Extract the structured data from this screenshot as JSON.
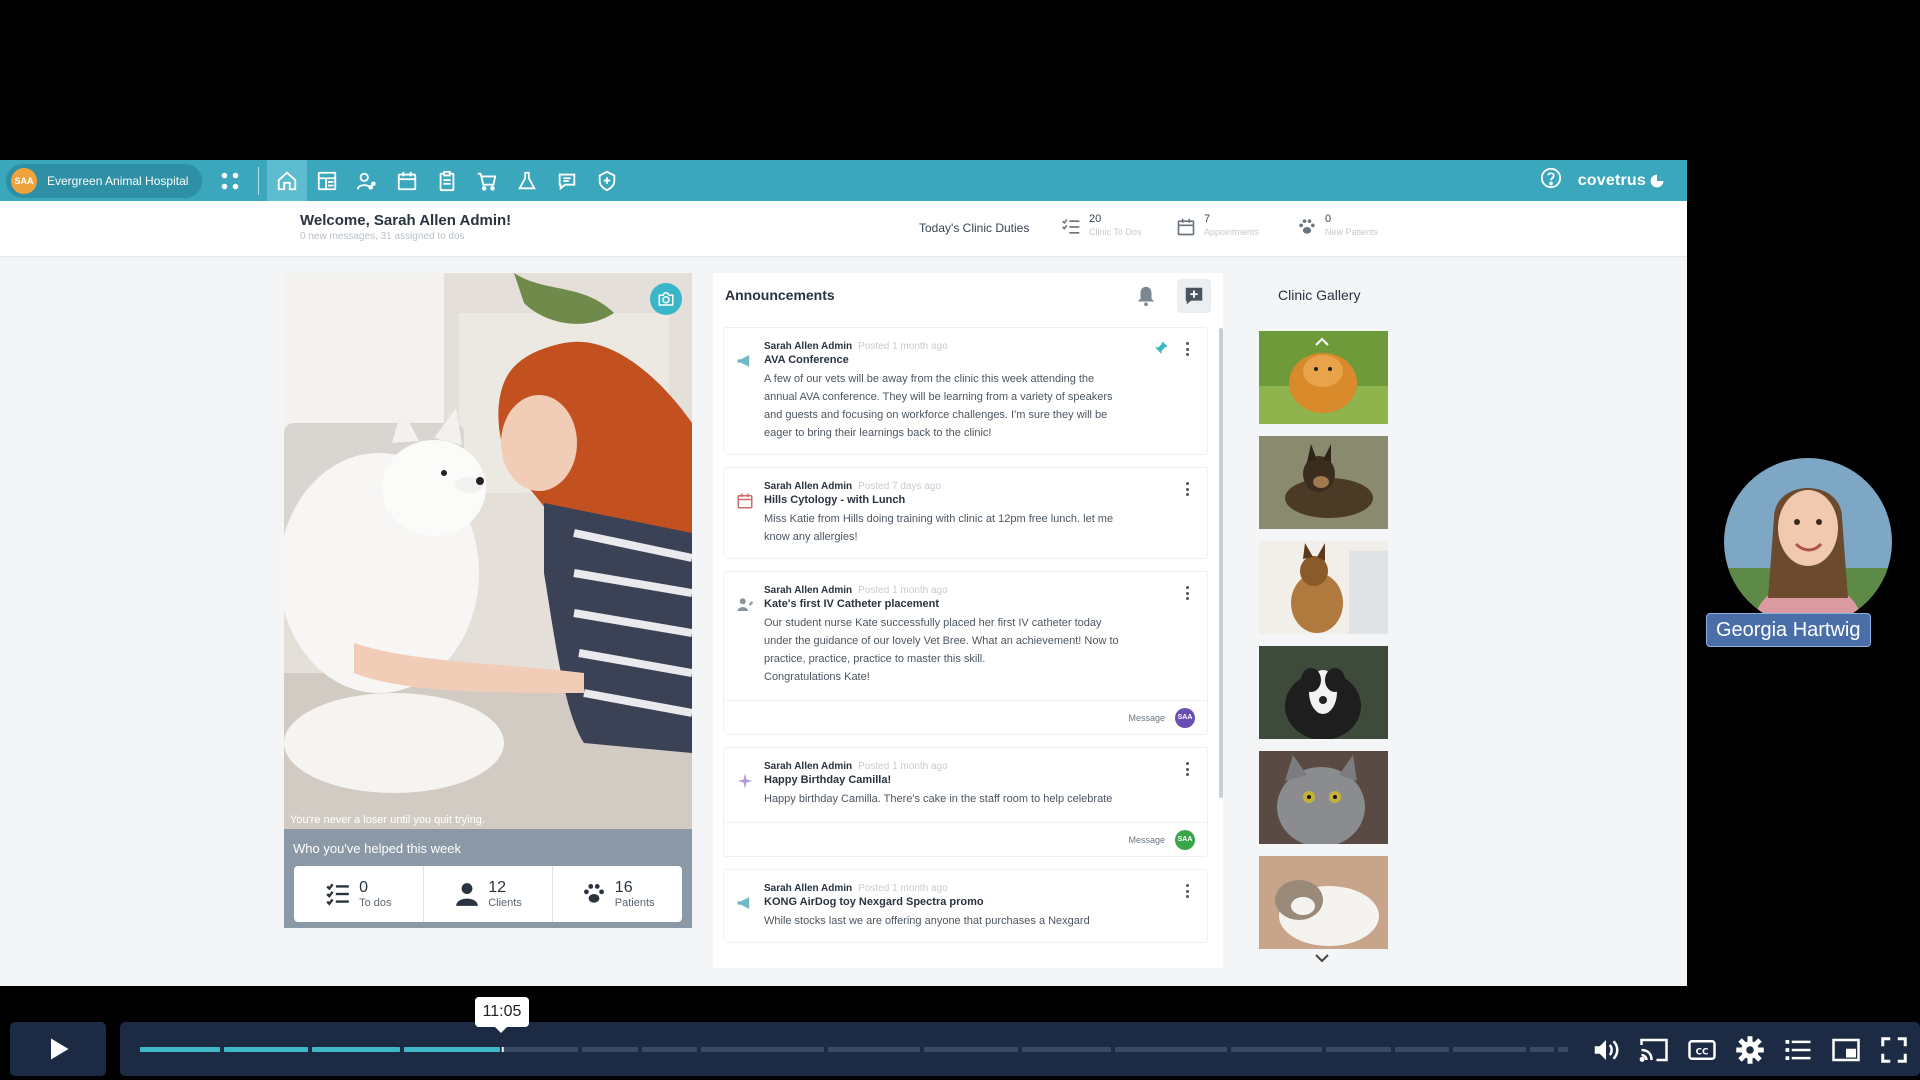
{
  "app": {
    "clinic": {
      "initials": "SAA",
      "name": "Evergreen Animal Hospital"
    },
    "brand": "covetrus",
    "nav_icons": [
      "apps-grid-icon",
      "home-icon",
      "dashboard-icon",
      "client-icon",
      "calendar-icon",
      "clipboard-icon",
      "cart-icon",
      "lab-flask-icon",
      "chat-icon",
      "shield-plus-icon"
    ],
    "welcome": {
      "title": "Welcome, Sarah Allen Admin!",
      "subtitle": "0 new messages, 31 assigned to dos"
    },
    "duties": {
      "label": "Today's Clinic Duties",
      "items": [
        {
          "icon": "checklist-icon",
          "count": "20",
          "label": "Clinic To Dos"
        },
        {
          "icon": "calendar-icon",
          "count": "7",
          "label": "Appointments"
        },
        {
          "icon": "paw-icon",
          "count": "0",
          "label": "New Patients"
        }
      ]
    },
    "hero": {
      "quote": "You're never a loser until you quit trying.",
      "helped_title": "Who you've helped this week",
      "stats": [
        {
          "icon": "checklist-icon",
          "value": "0",
          "label": "To dos"
        },
        {
          "icon": "person-icon",
          "value": "12",
          "label": "Clients"
        },
        {
          "icon": "paw-icon",
          "value": "16",
          "label": "Patients"
        }
      ]
    },
    "announcements": {
      "title": "Announcements",
      "posts": [
        {
          "icon": "megaphone-icon",
          "author": "Sarah Allen Admin",
          "time": "Posted 1 month ago",
          "title": "AVA Conference",
          "body": " A few of our vets will be away from the clinic this week attending the\nannual AVA conference. They will be learning from a variety of speakers\nand guests and focusing on workforce challenges. I'm sure they will be\neager to bring their learnings back to the clinic!",
          "pinned": true,
          "footer": null
        },
        {
          "icon": "calendar-icon",
          "author": "Sarah Allen Admin",
          "time": "Posted 7 days ago",
          "title": "Hills Cytology - with Lunch",
          "body": " Miss Katie from Hills doing training with clinic at 12pm free lunch. let me\nknow any allergies!",
          "pinned": false,
          "footer": null
        },
        {
          "icon": "person-edit-icon",
          "author": "Sarah Allen Admin",
          "time": "Posted 1 month ago",
          "title": "Kate's first IV Catheter placement",
          "body": " Our student nurse Kate successfully placed her first IV catheter today\nunder the guidance of our lovely Vet Bree. What an achievement! Now to\npractice, practice, practice to master this skill.\nCongratulations Kate!",
          "pinned": false,
          "footer": {
            "label": "Message",
            "initials": "SAA",
            "color": "#6a4fb3"
          }
        },
        {
          "icon": "sparkle-icon",
          "author": "Sarah Allen Admin",
          "time": "Posted 1 month ago",
          "title": "Happy Birthday Camilla!",
          "body": " Happy birthday Camilla. There's cake in the staff room to help celebrate",
          "pinned": false,
          "footer": {
            "label": "Message",
            "initials": "SAA",
            "color": "#3aa64a"
          }
        },
        {
          "icon": "megaphone-icon",
          "author": "Sarah Allen Admin",
          "time": "Posted 1 month ago",
          "title": "KONG AirDog toy Nexgard Spectra promo",
          "body": " While stocks last we are offering anyone that purchases a Nexgard",
          "pinned": false,
          "footer": null
        }
      ]
    },
    "gallery": {
      "title": "Clinic Gallery",
      "thumb_count": 6
    }
  },
  "webcam": {
    "name": "Georgia Hartwig"
  },
  "player": {
    "time_tooltip": "11:05",
    "progress": 0.254
  },
  "colors": {
    "topbar": "#3aa7bd",
    "accent": "#3ab6c9",
    "player_bg": "#1c2a44",
    "progress": "#3fb8c9"
  }
}
